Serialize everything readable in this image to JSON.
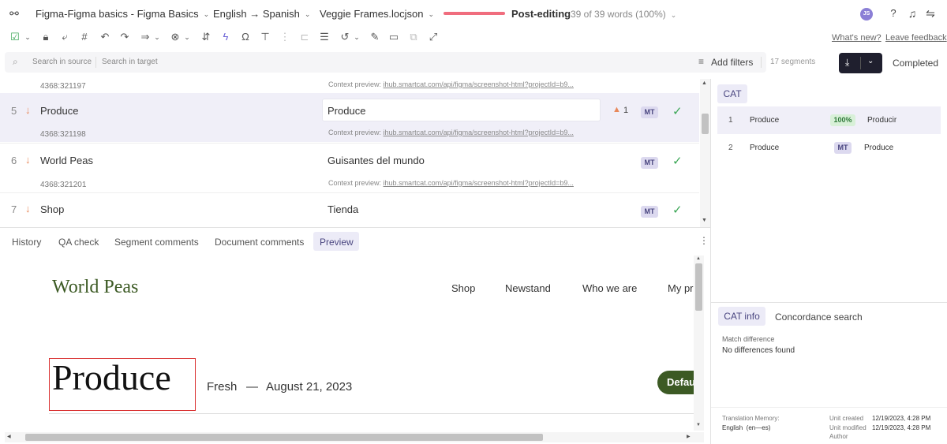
{
  "topbar": {
    "project": "Figma-Figma basics - Figma Basics",
    "language_pair": "English → Spanish",
    "file": "Veggie Frames.locjson",
    "stage": "Post-editing",
    "progress_text": "39 of 39 words",
    "progress_percent": "(100%)",
    "progress_value": 1.0,
    "avatar_initials": "JS"
  },
  "links": {
    "whats_new": "What's new?",
    "leave_feedback": "Leave feedback"
  },
  "search": {
    "source_placeholder": "Search in source",
    "target_placeholder": "Search in target",
    "add_filters": "Add filters",
    "segment_count": "17 segments",
    "status": "Completed"
  },
  "segments": [
    {
      "id_above": "4368:321197",
      "context_label": "Context preview:",
      "context_link": "ihub.smartcat.com/api/figma/screenshot-html?projectId=b9..."
    },
    {
      "num": "5",
      "source": "Produce",
      "target": "Produce",
      "warnings": "1",
      "badge": "MT",
      "id": "4368:321198",
      "context_label": "Context preview:",
      "context_link": "ihub.smartcat.com/api/figma/screenshot-html?projectId=b9..."
    },
    {
      "num": "6",
      "source": "World Peas",
      "target": "Guisantes del mundo",
      "badge": "MT",
      "id": "4368:321201",
      "context_label": "Context preview:",
      "context_link": "ihub.smartcat.com/api/figma/screenshot-html?projectId=b9..."
    },
    {
      "num": "7",
      "source": "Shop",
      "target": "Tienda",
      "badge": "MT"
    }
  ],
  "bottom_tabs": [
    "History",
    "QA check",
    "Segment comments",
    "Document comments",
    "Preview"
  ],
  "preview": {
    "logo": "World Peas",
    "nav": [
      "Shop",
      "Newstand",
      "Who we are",
      "My pr"
    ],
    "heading": "Produce",
    "subheading_left": "Fresh",
    "dash": "—",
    "date": "August 21, 2023",
    "button": "Defau"
  },
  "cat": {
    "tab": "CAT",
    "matches": [
      {
        "num": "1",
        "source": "Produce",
        "badge": "100%",
        "target": "Producir"
      },
      {
        "num": "2",
        "source": "Produce",
        "badge": "MT",
        "target": "Produce"
      }
    ]
  },
  "info_tabs": [
    "CAT info",
    "Concordance search"
  ],
  "info": {
    "match_diff_label": "Match difference",
    "match_diff_value": "No differences found",
    "tm_label": "Translation Memory:",
    "tm_value": "English  (en—es)",
    "unit_created_label": "Unit created",
    "unit_created_value": "12/19/2023, 4:28 PM",
    "unit_modified_label": "Unit modified",
    "unit_modified_value": "12/19/2023, 4:28 PM",
    "author_label": "Author"
  },
  "colors": {
    "accent": "#4a4680",
    "progress": "#f06d7e",
    "ok": "#3aa655",
    "warn": "#e8885a",
    "selected_row": "#f0eff8"
  }
}
